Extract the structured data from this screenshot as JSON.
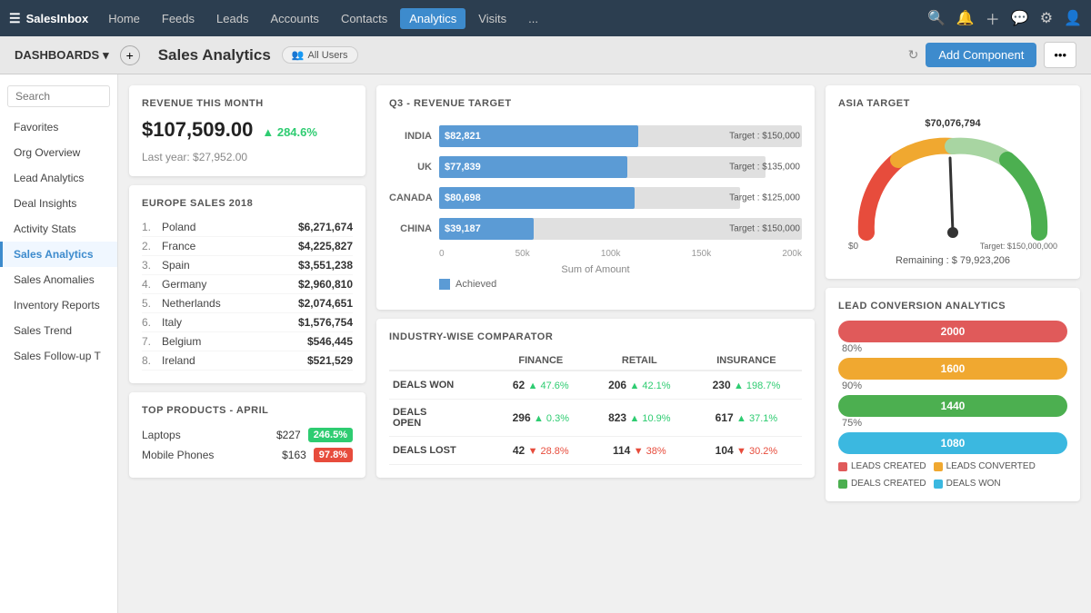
{
  "nav": {
    "brand": "SalesInbox",
    "items": [
      "Home",
      "Feeds",
      "Leads",
      "Accounts",
      "Contacts",
      "Analytics",
      "Visits",
      "..."
    ]
  },
  "subheader": {
    "dashboards_label": "DASHBOARDS",
    "title": "Sales Analytics",
    "badge": "All Users",
    "add_component": "Add Component"
  },
  "sidebar": {
    "search_placeholder": "Search",
    "items": [
      {
        "label": "Favorites",
        "active": false
      },
      {
        "label": "Org Overview",
        "active": false
      },
      {
        "label": "Lead Analytics",
        "active": false
      },
      {
        "label": "Deal Insights",
        "active": false
      },
      {
        "label": "Activity Stats",
        "active": false
      },
      {
        "label": "Sales Analytics",
        "active": true
      },
      {
        "label": "Sales Anomalies",
        "active": false
      },
      {
        "label": "Inventory Reports",
        "active": false
      },
      {
        "label": "Sales Trend",
        "active": false
      },
      {
        "label": "Sales Follow-up T",
        "active": false
      }
    ]
  },
  "revenue": {
    "title": "REVENUE THIS MONTH",
    "amount": "$107,509.00",
    "change": "284.6%",
    "last_year_label": "Last year: $27,952.00"
  },
  "europe_sales": {
    "title": "EUROPE SALES 2018",
    "items": [
      {
        "rank": "1.",
        "country": "Poland",
        "amount": "$6,271,674"
      },
      {
        "rank": "2.",
        "country": "France",
        "amount": "$4,225,827"
      },
      {
        "rank": "3.",
        "country": "Spain",
        "amount": "$3,551,238"
      },
      {
        "rank": "4.",
        "country": "Germany",
        "amount": "$2,960,810"
      },
      {
        "rank": "5.",
        "country": "Netherlands",
        "amount": "$2,074,651"
      },
      {
        "rank": "6.",
        "country": "Italy",
        "amount": "$1,576,754"
      },
      {
        "rank": "7.",
        "country": "Belgium",
        "amount": "$546,445"
      },
      {
        "rank": "8.",
        "country": "Ireland",
        "amount": "$521,529"
      }
    ]
  },
  "top_products": {
    "title": "TOP PRODUCTS - APRIL",
    "items": [
      {
        "name": "Laptops",
        "price": "$227",
        "badge": "246.5%",
        "badge_type": "green"
      },
      {
        "name": "Mobile Phones",
        "price": "$163",
        "badge": "97.8%",
        "badge_type": "red"
      }
    ]
  },
  "q3_revenue": {
    "title": "Q3 - REVENUE TARGET",
    "bars": [
      {
        "label": "INDIA",
        "value": "$82,821",
        "fill_pct": 55,
        "target": "Target : $150,000",
        "target_pct": 100
      },
      {
        "label": "UK",
        "value": "$77,839",
        "fill_pct": 52,
        "target": "Target : $135,000",
        "target_pct": 90
      },
      {
        "label": "CANADA",
        "value": "$80,698",
        "fill_pct": 54,
        "target": "Target : $125,000",
        "target_pct": 83
      },
      {
        "label": "CHINA",
        "value": "$39,187",
        "fill_pct": 26,
        "target": "Target : $150,000",
        "target_pct": 100
      }
    ],
    "xaxis": [
      "0",
      "50k",
      "100k",
      "150k",
      "200k"
    ],
    "xlabel": "Sum of Amount",
    "legend": "Achieved"
  },
  "industry": {
    "title": "INDUSTRY-WISE COMPARATOR",
    "headers": [
      "",
      "FINANCE",
      "RETAIL",
      "INSURANCE"
    ],
    "rows": [
      {
        "label": "DEALS WON",
        "finance": {
          "val": "62",
          "pct": "47.6%",
          "dir": "up"
        },
        "retail": {
          "val": "206",
          "pct": "42.1%",
          "dir": "up"
        },
        "insurance": {
          "val": "230",
          "pct": "198.7%",
          "dir": "up"
        }
      },
      {
        "label": "DEALS OPEN",
        "finance": {
          "val": "296",
          "pct": "0.3%",
          "dir": "up"
        },
        "retail": {
          "val": "823",
          "pct": "10.9%",
          "dir": "up"
        },
        "insurance": {
          "val": "617",
          "pct": "37.1%",
          "dir": "up"
        }
      },
      {
        "label": "DEALS LOST",
        "finance": {
          "val": "42",
          "pct": "28.8%",
          "dir": "down"
        },
        "retail": {
          "val": "114",
          "pct": "38%",
          "dir": "down"
        },
        "insurance": {
          "val": "104",
          "pct": "30.2%",
          "dir": "down"
        }
      }
    ]
  },
  "asia_target": {
    "title": "ASIA TARGET",
    "top_value": "$70,076,794",
    "min": "$0",
    "max": "Target: $150,000,000",
    "remaining": "Remaining : $ 79,923,206"
  },
  "lead_conversion": {
    "title": "LEAD CONVERSION ANALYTICS",
    "bars": [
      {
        "value": "2000",
        "pct": "80%",
        "color": "#e05a5a"
      },
      {
        "value": "1600",
        "pct": "90%",
        "color": "#f0a830"
      },
      {
        "value": "1440",
        "pct": "75%",
        "color": "#4caf50"
      },
      {
        "value": "1080",
        "pct": "",
        "color": "#3bb8e0"
      }
    ],
    "legend": [
      {
        "label": "LEADS CREATED",
        "color": "#e05a5a"
      },
      {
        "label": "LEADS CONVERTED",
        "color": "#f0a830"
      },
      {
        "label": "DEALS CREATED",
        "color": "#4caf50"
      },
      {
        "label": "DEALS WON",
        "color": "#3bb8e0"
      }
    ]
  }
}
